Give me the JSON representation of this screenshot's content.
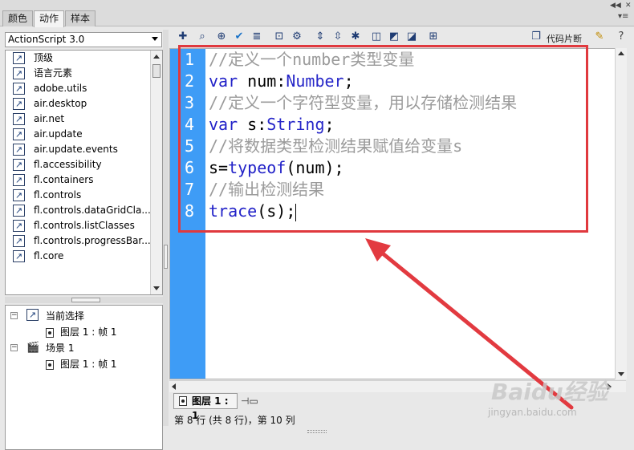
{
  "tabs": [
    {
      "label": "颜色",
      "active": false
    },
    {
      "label": "动作",
      "active": true
    },
    {
      "label": "样本",
      "active": false
    }
  ],
  "left_panel": {
    "version_select": "ActionScript 3.0",
    "items": [
      {
        "label": "顶级"
      },
      {
        "label": "语言元素"
      },
      {
        "label": "adobe.utils"
      },
      {
        "label": "air.desktop"
      },
      {
        "label": "air.net"
      },
      {
        "label": "air.update"
      },
      {
        "label": "air.update.events"
      },
      {
        "label": "fl.accessibility"
      },
      {
        "label": "fl.containers"
      },
      {
        "label": "fl.controls"
      },
      {
        "label": "fl.controls.dataGridCla..."
      },
      {
        "label": "fl.controls.listClasses"
      },
      {
        "label": "fl.controls.progressBar..."
      },
      {
        "label": "fl.core"
      }
    ],
    "tree": {
      "current_selection": "当前选择",
      "current_child": "图层 1 : 帧 1",
      "scene": "场景 1",
      "scene_child": "图层 1 : 帧 1"
    }
  },
  "toolbar": {
    "snippets_label": "代码片断",
    "tools": [
      "add-icon",
      "find-icon",
      "target-icon",
      "check-syntax-icon",
      "auto-format-icon",
      "code-hint-icon",
      "debug-icon",
      "collapse-icon",
      "collapse-selection-icon",
      "expand-all-icon",
      "comment-block-icon",
      "comment-line-icon",
      "uncomment-icon",
      "script-assist-icon"
    ]
  },
  "editor": {
    "lines": [
      {
        "num": "1",
        "parts": [
          {
            "t": "//定义一个number类型变量",
            "k": "comment"
          }
        ]
      },
      {
        "num": "2",
        "parts": [
          {
            "t": "var",
            "k": "kw"
          },
          {
            "t": " num:",
            "k": "plain"
          },
          {
            "t": "Number",
            "k": "type"
          },
          {
            "t": ";",
            "k": "plain"
          }
        ]
      },
      {
        "num": "3",
        "parts": [
          {
            "t": "//定义一个字符型变量，用以存储检测结果",
            "k": "comment"
          }
        ]
      },
      {
        "num": "4",
        "parts": [
          {
            "t": "var",
            "k": "kw"
          },
          {
            "t": " s:",
            "k": "plain"
          },
          {
            "t": "String",
            "k": "type"
          },
          {
            "t": ";",
            "k": "plain"
          }
        ]
      },
      {
        "num": "5",
        "parts": [
          {
            "t": "//将数据类型检测结果赋值给变量s",
            "k": "comment"
          }
        ]
      },
      {
        "num": "6",
        "parts": [
          {
            "t": "s=",
            "k": "plain"
          },
          {
            "t": "typeof",
            "k": "kw"
          },
          {
            "t": "(num);",
            "k": "plain"
          }
        ]
      },
      {
        "num": "7",
        "parts": [
          {
            "t": "//输出检测结果",
            "k": "comment"
          }
        ]
      },
      {
        "num": "8",
        "parts": [
          {
            "t": "trace",
            "k": "kw"
          },
          {
            "t": "(s);",
            "k": "plain"
          }
        ]
      }
    ]
  },
  "scene_tab": "图层 1 : 1",
  "status_bar": "第 8 行 (共 8 行)，第 10 列",
  "watermark": {
    "brand": "Baidu经验",
    "url": "jingyan.baidu.com"
  },
  "colors": {
    "gutter": "#3e9cf6",
    "highlight_box": "#e0393e",
    "keyword": "#2222c8",
    "comment": "#9b9b9b"
  }
}
